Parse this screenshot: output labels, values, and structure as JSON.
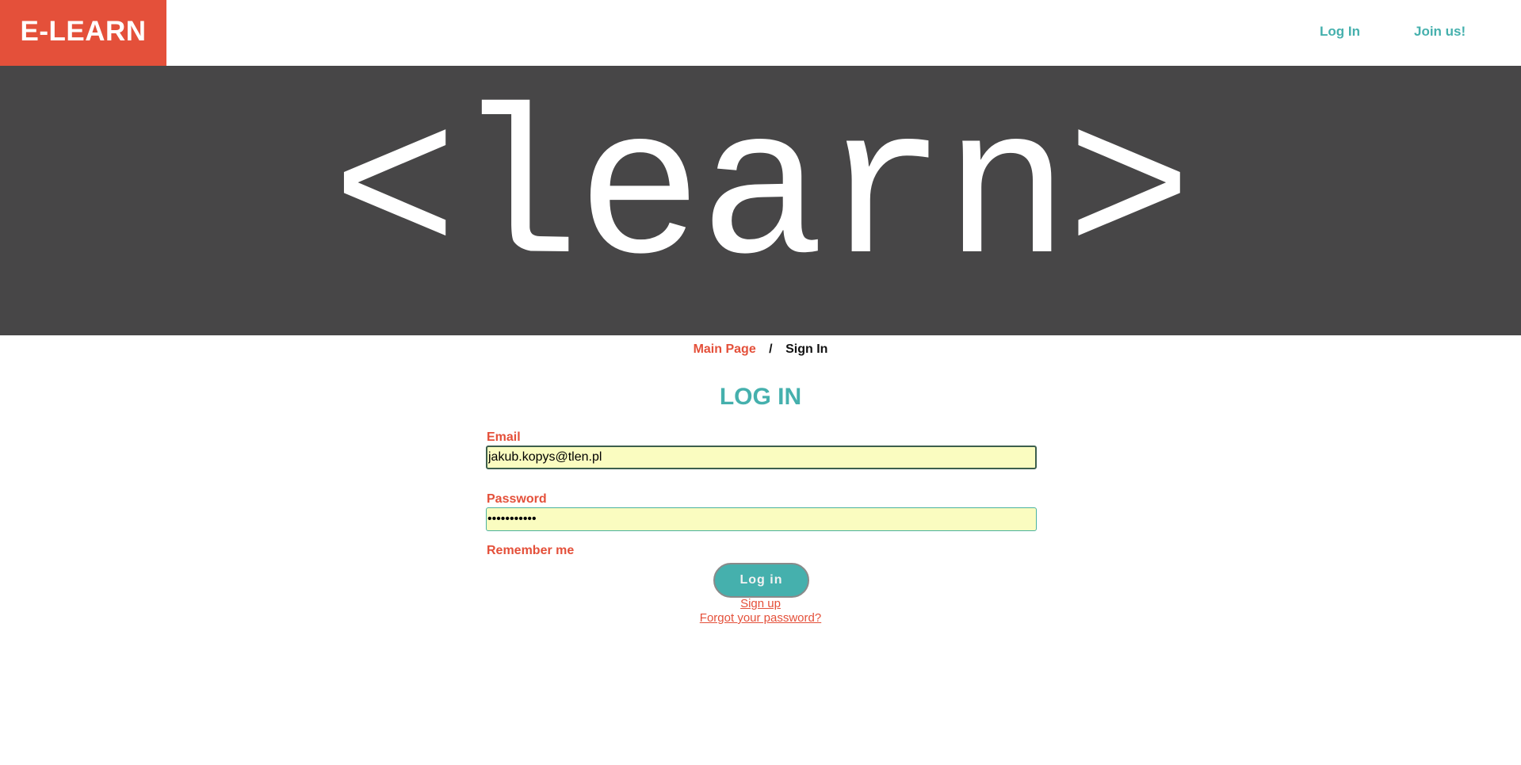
{
  "header": {
    "logo": "E-LEARN",
    "nav": {
      "login": "Log In",
      "join": "Join us!"
    }
  },
  "hero": {
    "text": "<learn>"
  },
  "breadcrumb": {
    "home": "Main Page",
    "separator": "/",
    "current": "Sign In"
  },
  "form": {
    "title": "LOG IN",
    "email_label": "Email",
    "email_value": "jakub.kopys@tlen.pl",
    "password_label": "Password",
    "password_value": "***********",
    "remember_label": "Remember me",
    "submit_label": "Log in",
    "signup_link": "Sign up",
    "forgot_link": "Forgot your password?"
  },
  "colors": {
    "brand": "#e4503a",
    "accent": "#45b0ad",
    "hero_bg": "#474647",
    "input_bg": "#fafcc0"
  }
}
